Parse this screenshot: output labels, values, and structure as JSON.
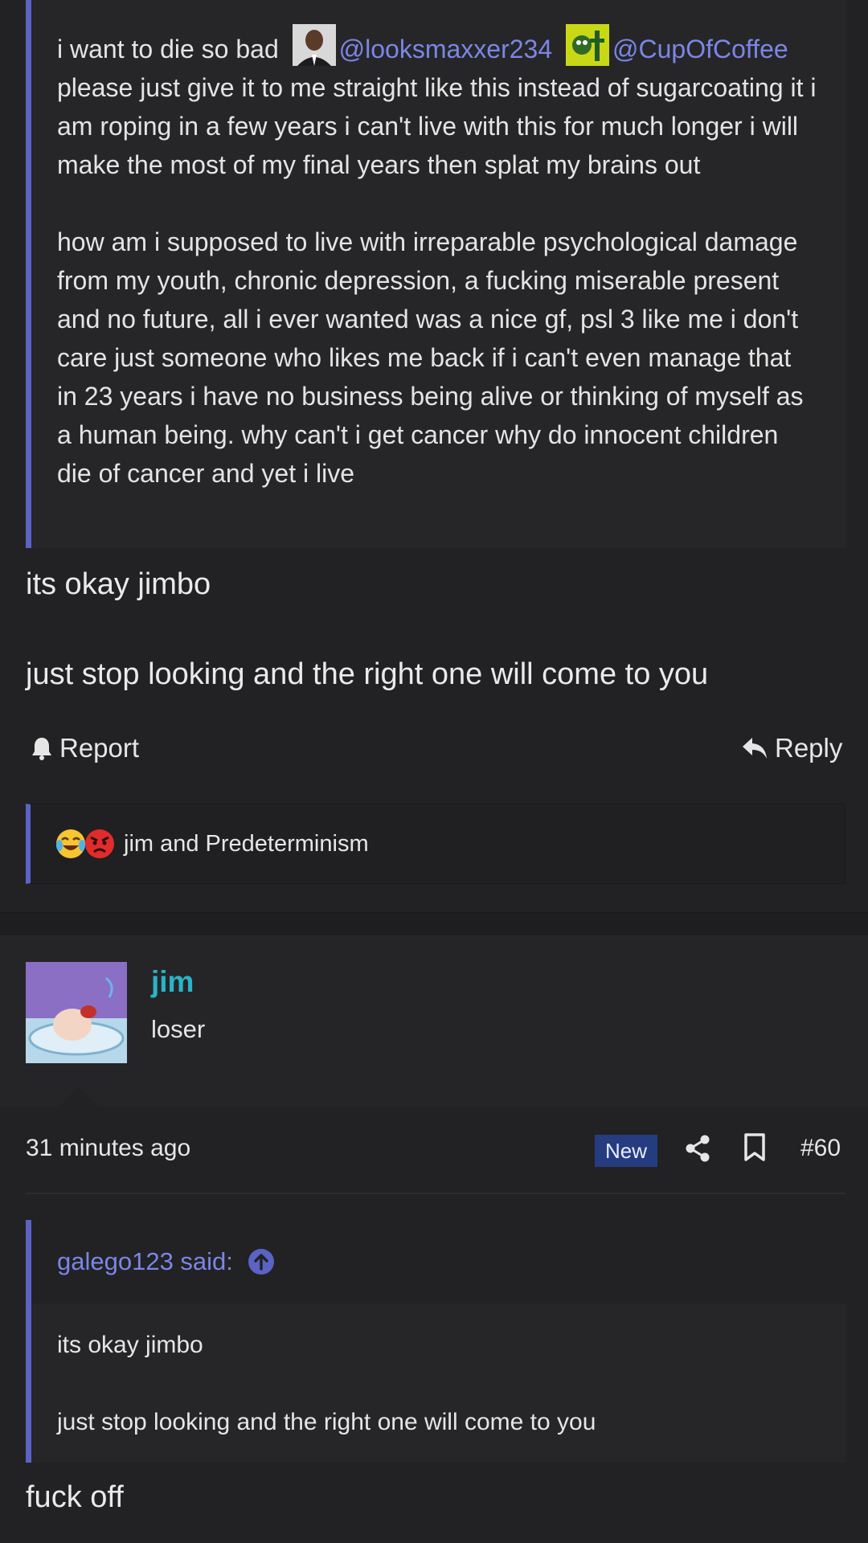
{
  "quote1": {
    "line1_text": "i want to die so bad",
    "mention1": "@looksmaxxer234",
    "mention2": "@CupOfCoffee",
    "paragraph1_rest": "please just give it to me straight like this instead of sugarcoating it i am roping in a few years i can't live with this for much longer i will make the most of my final years then splat my brains out",
    "paragraph2": "how am i supposed to live with irreparable psychological damage from my youth, chronic depression, a fucking miserable present and no future, all i ever wanted was a nice gf, psl 3 like me i don't care just someone who likes me back if i can't even manage that in 23 years i have no business being alive or thinking of myself as a human being. why can't i get cancer why do innocent children die of cancer and yet i live"
  },
  "post1": {
    "line1": "its okay jimbo",
    "line2": "just stop looking and the right one will come to you"
  },
  "actions": {
    "report_label": "Report",
    "reply_label": "Reply"
  },
  "reactions": {
    "text": "jim and Predeterminism",
    "icons": [
      "crying-laughing-emoji",
      "angry-face-emoji"
    ]
  },
  "post2": {
    "author_name": "jim",
    "author_title": "loser",
    "time": "31 minutes ago",
    "new_badge": "New",
    "post_number": "#60",
    "quote": {
      "attribution": "galego123 said:",
      "line1": "its okay jimbo",
      "line2": "just stop looking and the right one will come to you"
    },
    "reply_text": "fuck off"
  },
  "colors": {
    "background": "#222224",
    "quote_border": "#5b63c4",
    "mention": "#7b86e6",
    "username": "#2ab3c9",
    "new_badge": "#263c80"
  }
}
